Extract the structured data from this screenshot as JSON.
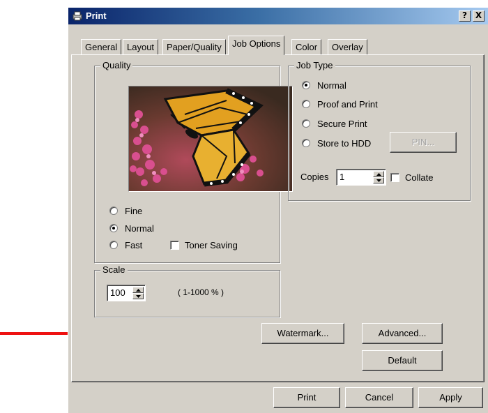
{
  "window": {
    "title": "Print",
    "help_button": "?",
    "close_button": "X"
  },
  "tabs": [
    {
      "label": "General"
    },
    {
      "label": "Layout"
    },
    {
      "label": "Paper/Quality"
    },
    {
      "label": "Job Options",
      "active": true
    },
    {
      "label": "Color"
    },
    {
      "label": "Overlay"
    }
  ],
  "quality": {
    "legend": "Quality",
    "options": [
      {
        "label": "Fine",
        "checked": false
      },
      {
        "label": "Normal",
        "checked": true
      },
      {
        "label": "Fast",
        "checked": false
      }
    ],
    "toner_saving": {
      "label": "Toner Saving",
      "checked": false
    }
  },
  "scale": {
    "legend": "Scale",
    "value": "100",
    "range_note": "( 1-1000 % )"
  },
  "job_type": {
    "legend": "Job Type",
    "options": [
      {
        "label": "Normal",
        "checked": true
      },
      {
        "label": "Proof and Print",
        "checked": false
      },
      {
        "label": "Secure Print",
        "checked": false
      },
      {
        "label": "Store to HDD",
        "checked": false
      }
    ],
    "pin_button": "PIN...",
    "copies_label": "Copies",
    "copies_value": "1",
    "collate": {
      "label": "Collate",
      "checked": false
    }
  },
  "buttons": {
    "watermark": "Watermark...",
    "advanced": "Advanced...",
    "default": "Default",
    "print": "Print",
    "cancel": "Cancel",
    "apply": "Apply"
  },
  "colors": {
    "titlebar_start": "#0a246a",
    "titlebar_end": "#a6caf0",
    "dialog_face": "#d4d0c8",
    "annotation_arrow": "#ee1111"
  }
}
